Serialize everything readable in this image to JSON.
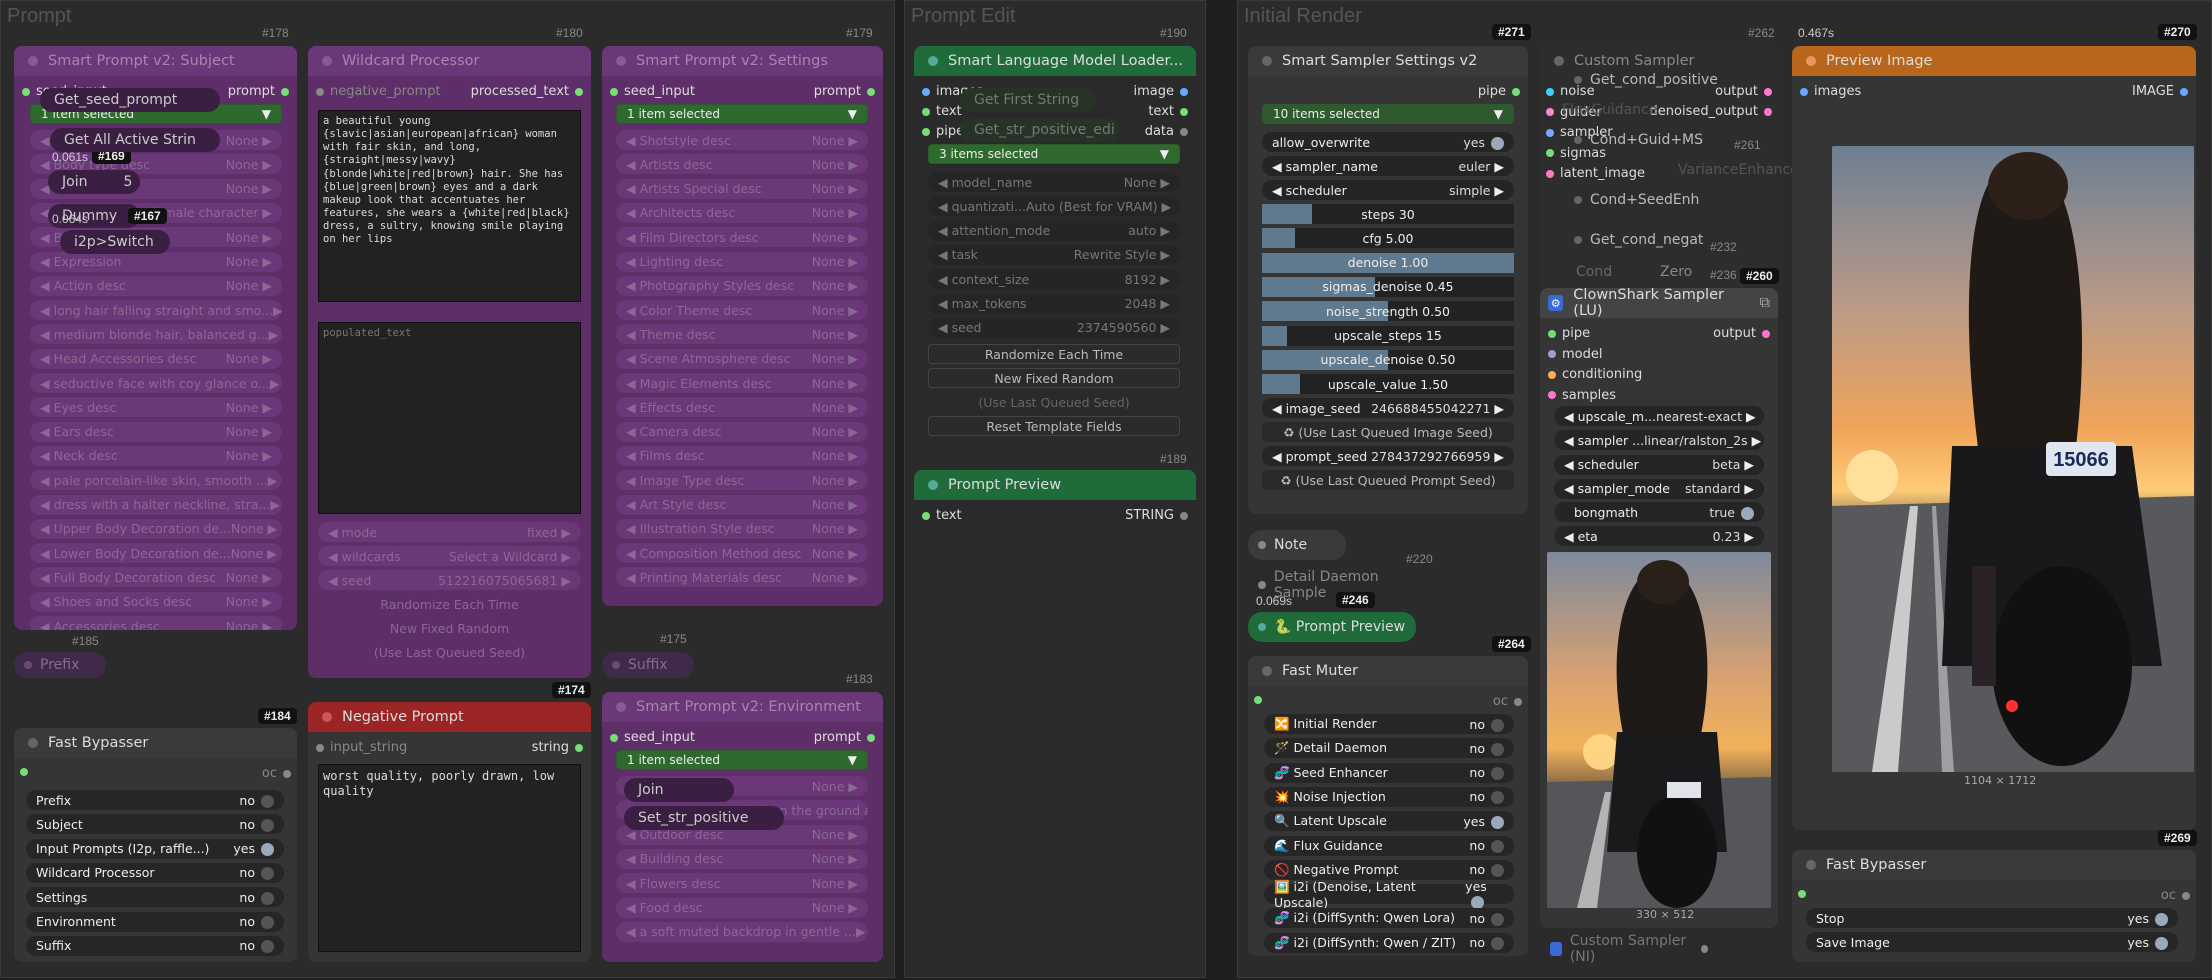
{
  "groups": {
    "prompt": "Prompt",
    "prompt_edit": "Prompt Edit",
    "initial_render": "Initial Render"
  },
  "subject": {
    "id": "#178",
    "title": "Smart Prompt v2: Subject",
    "in": "seed_input",
    "out": "prompt",
    "select": "1 item selected",
    "rows": [
      {
        "l": "Subject desc",
        "v": "None"
      },
      {
        "l": "Body type desc",
        "v": "None"
      },
      {
        "l": "Hair desc",
        "v": "None"
      },
      {
        "l": "Style desc",
        "v": "female character"
      },
      {
        "l": "Body desc",
        "v": "None"
      },
      {
        "l": "Expression",
        "v": "None"
      },
      {
        "l": "Action desc",
        "v": "None"
      },
      {
        "l": "long hair falling straight and smo...",
        "v": ""
      },
      {
        "l": "medium blonde hair, balanced g...",
        "v": ""
      },
      {
        "l": "Head Accessories desc",
        "v": "None"
      },
      {
        "l": "seductive face with coy glance o...",
        "v": ""
      },
      {
        "l": "Eyes desc",
        "v": "None"
      },
      {
        "l": "Ears desc",
        "v": "None"
      },
      {
        "l": "Neck desc",
        "v": "None"
      },
      {
        "l": "pale porcelain-like skin, smooth ...",
        "v": ""
      },
      {
        "l": "dress with a halter neckline, stra...",
        "v": ""
      },
      {
        "l": "Upper Body Decoration de...",
        "v": "None"
      },
      {
        "l": "Lower Body Decoration de...",
        "v": "None"
      },
      {
        "l": "Full Body Decoration desc",
        "v": "None"
      },
      {
        "l": "Shoes and Socks desc",
        "v": "None"
      },
      {
        "l": "Accessories desc",
        "v": "None"
      }
    ],
    "overlay": [
      "Get_seed_prompt",
      "Get All Active Strin",
      "Join",
      "Dummy",
      "i2p>Switch"
    ],
    "t1": "0.061s",
    "id169": "#169",
    "t2": "0.064s",
    "id167": "#167",
    "n5": "5"
  },
  "wildcard": {
    "id": "#180",
    "title": "Wildcard Processor",
    "in": "negative_prompt",
    "out": "processed_text",
    "text": "a beautiful young {slavic|asian|european|african} woman with fair skin, and long, {straight|messy|wavy} {blonde|white|red|brown} hair. She has {blue|green|brown} eyes and a dark makeup look that accentuates her features, she wears a {white|red|black} dress, a sultry, knowing smile playing on her lips",
    "placeholder": "populated_text",
    "rows": [
      {
        "l": "mode",
        "v": "fixed"
      },
      {
        "l": "wildcards",
        "v": "Select a Wildcard"
      },
      {
        "l": "seed",
        "v": "512216075065681"
      }
    ],
    "btn1": "Randomize Each Time",
    "btn2": "New Fixed Random",
    "btn3": "(Use Last Queued Seed)"
  },
  "settings": {
    "id": "#179",
    "title": "Smart Prompt v2: Settings",
    "in": "seed_input",
    "out": "prompt",
    "select": "1 item selected",
    "rows": [
      {
        "l": "Shotstyle desc",
        "v": "None"
      },
      {
        "l": "Artists desc",
        "v": "None"
      },
      {
        "l": "Artists Special desc",
        "v": "None"
      },
      {
        "l": "Architects desc",
        "v": "None"
      },
      {
        "l": "Film Directors desc",
        "v": "None"
      },
      {
        "l": "Lighting desc",
        "v": "None"
      },
      {
        "l": "Photography Styles desc",
        "v": "None"
      },
      {
        "l": "Color Theme desc",
        "v": "None"
      },
      {
        "l": "Theme desc",
        "v": "None"
      },
      {
        "l": "Scene Atmosphere desc",
        "v": "None"
      },
      {
        "l": "Magic Elements desc",
        "v": "None"
      },
      {
        "l": "Effects desc",
        "v": "None"
      },
      {
        "l": "Camera desc",
        "v": "None"
      },
      {
        "l": "Films desc",
        "v": "None"
      },
      {
        "l": "Image Type desc",
        "v": "None"
      },
      {
        "l": "Art Style desc",
        "v": "None"
      },
      {
        "l": "Illustration Style desc",
        "v": "None"
      },
      {
        "l": "Composition Method desc",
        "v": "None"
      },
      {
        "l": "Printing Materials desc",
        "v": "None"
      }
    ]
  },
  "prefix": {
    "id": "#185",
    "label": "Prefix"
  },
  "suffix": {
    "id": "#175",
    "label": "Suffix"
  },
  "bypass1": {
    "id": "#184",
    "title": "Fast Bypasser",
    "oc": "oc",
    "rows": [
      {
        "l": "Prefix",
        "v": "no",
        "on": false
      },
      {
        "l": "Subject",
        "v": "no",
        "on": false
      },
      {
        "l": "Input Prompts (I2p, raffle...)",
        "v": "yes",
        "on": true
      },
      {
        "l": "Wildcard Processor",
        "v": "no",
        "on": false
      },
      {
        "l": "Settings",
        "v": "no",
        "on": false
      },
      {
        "l": "Environment",
        "v": "no",
        "on": false
      },
      {
        "l": "Suffix",
        "v": "no",
        "on": false
      }
    ]
  },
  "negative": {
    "id": "#174",
    "title": "Negative Prompt",
    "in": "input_string",
    "out": "string",
    "text": "worst quality, poorly drawn, low quality"
  },
  "environment": {
    "id": "#183",
    "title": "Smart Prompt v2: Environment",
    "in": "seed_input",
    "out": "prompt",
    "select": "1 item selected",
    "rows": [
      {
        "l": "Location desc",
        "v": "None"
      },
      {
        "l": "a motorcycle parked on the ground around",
        "v": ""
      },
      {
        "l": "Outdoor desc",
        "v": "None"
      },
      {
        "l": "Building desc",
        "v": "None"
      },
      {
        "l": "Flowers desc",
        "v": "None"
      },
      {
        "l": "Food desc",
        "v": "None"
      },
      {
        "l": "a soft muted backdrop in gentle ...",
        "v": ""
      }
    ],
    "overlay": [
      "Join",
      "Set_str_positive"
    ]
  },
  "slm": {
    "id": "#190",
    "title": "Smart Language Model Loader...",
    "ins": [
      "images",
      "text",
      "pipe_opt"
    ],
    "outs": [
      "image",
      "text",
      "data"
    ],
    "select": "3 items selected",
    "rows": [
      {
        "l": "model_name",
        "v": "None"
      },
      {
        "l": "quantizati...",
        "v": "Auto (Best for VRAM)"
      },
      {
        "l": "attention_mode",
        "v": "auto"
      },
      {
        "l": "task",
        "v": "Rewrite Style"
      },
      {
        "l": "context_size",
        "v": "8192"
      },
      {
        "l": "max_tokens",
        "v": "2048"
      },
      {
        "l": "seed",
        "v": "2374590560"
      }
    ],
    "btn1": "Randomize Each Time",
    "btn2": "New Fixed Random",
    "btn3": "(Use Last Queued Seed)",
    "btn4": "Reset Template Fields",
    "overlay": [
      "Get First String",
      "Get_str_positive_edi"
    ],
    "n4": "4"
  },
  "preview1": {
    "id": "#189",
    "title": "Prompt Preview",
    "in": "text",
    "out": "STRING"
  },
  "sampler_settings": {
    "id": "#271",
    "title": "Smart Sampler Settings v2",
    "out": "pipe",
    "select": "10 items selected",
    "allow": {
      "l": "allow_overwrite",
      "v": "yes"
    },
    "sampler": {
      "l": "sampler_name",
      "v": "euler"
    },
    "scheduler": {
      "l": "scheduler",
      "v": "simple"
    },
    "sliders": [
      {
        "l": "steps",
        "v": "30",
        "f": 0.2
      },
      {
        "l": "cfg",
        "v": "5.00",
        "f": 0.13
      },
      {
        "l": "denoise",
        "v": "1.00",
        "f": 1.0
      },
      {
        "l": "sigmas_denoise",
        "v": "0.45",
        "f": 0.45
      },
      {
        "l": "noise_strength",
        "v": "0.50",
        "f": 0.5
      },
      {
        "l": "upscale_steps",
        "v": "15",
        "f": 0.1
      },
      {
        "l": "upscale_denoise",
        "v": "0.50",
        "f": 0.5
      },
      {
        "l": "upscale_value",
        "v": "1.50",
        "f": 0.15
      }
    ],
    "image_seed": {
      "l": "image_seed",
      "v": "246688455042271"
    },
    "btn1": "(Use Last Queued Image Seed)",
    "prompt_seed": {
      "l": "prompt_seed",
      "v": "278437292766959"
    },
    "btn2": "(Use Last Queued Prompt Seed)"
  },
  "custom_sampler": {
    "id": "#262",
    "title": "Custom Sampler",
    "ins": [
      "noise",
      "guider",
      "sampler",
      "sigmas",
      "latent_image"
    ],
    "outs": [
      "output",
      "denoised_output"
    ],
    "overlay": [
      "Get_cond_positive",
      "FluxGuidance",
      "Cond+Guid+MS",
      "VarianceEnhancer",
      "Cond+SeedEnh",
      "Get_cond_negat",
      "Cond",
      "Zero"
    ],
    "id261": "#261",
    "id232": "#232",
    "id236": "#236"
  },
  "clownshark": {
    "id": "#260",
    "title": "ClownShark Sampler (LU)",
    "ins": [
      "pipe",
      "model",
      "conditioning",
      "samples"
    ],
    "out": "output",
    "rows": [
      {
        "l": "upscale_m...",
        "v": "nearest-exact"
      },
      {
        "l": "sampler ...",
        "v": "linear/ralston_2s"
      },
      {
        "l": "scheduler",
        "v": "beta"
      },
      {
        "l": "sampler_mode",
        "v": "standard"
      }
    ],
    "bongmath": {
      "l": "bongmath",
      "v": "true"
    },
    "eta": {
      "l": "eta",
      "v": "0.23"
    },
    "caption": "330 × 512"
  },
  "note": {
    "label": "Note"
  },
  "daemon": {
    "label": "Detail Daemon Sample",
    "id": "#220",
    "time": "0.069s",
    "id246": "#246"
  },
  "preview2": {
    "label": "Prompt Preview"
  },
  "muter": {
    "id": "#264",
    "title": "Fast Muter",
    "oc": "oc",
    "rows": [
      {
        "l": "🔀 Initial Render",
        "v": "no",
        "on": false
      },
      {
        "l": "🪄 Detail Daemon",
        "v": "no",
        "on": false
      },
      {
        "l": "🧬 Seed Enhancer",
        "v": "no",
        "on": false
      },
      {
        "l": "💥 Noise Injection",
        "v": "no",
        "on": false
      },
      {
        "l": "🔍 Latent Upscale",
        "v": "yes",
        "on": true
      },
      {
        "l": "🌊 Flux Guidance",
        "v": "no",
        "on": false
      },
      {
        "l": "🚫 Negative Prompt",
        "v": "no",
        "on": false
      },
      {
        "l": "🖼️ i2i (Denoise, Latent Upscale)",
        "v": "yes",
        "on": true
      },
      {
        "l": "🧬 i2i (DiffSynth: Qwen Lora)",
        "v": "no",
        "on": false
      },
      {
        "l": "🧬 i2i (DiffSynth: Qwen / ZIT)",
        "v": "no",
        "on": false
      }
    ]
  },
  "custom2": {
    "label": "Custom Sampler (NI)"
  },
  "preview_image": {
    "id": "#270",
    "title": "Preview Image",
    "time": "0.467s",
    "in": "images",
    "out": "IMAGE",
    "caption": "1104 × 1712",
    "plate": "15066"
  },
  "bypass2": {
    "id": "#269",
    "title": "Fast Bypasser",
    "oc": "oc",
    "rows": [
      {
        "l": "Stop",
        "v": "yes",
        "on": true
      },
      {
        "l": "Save Image",
        "v": "yes",
        "on": true
      }
    ]
  },
  "colors": {
    "purple": "#5e2e68",
    "green": "#1f6b3a",
    "red": "#9b2424",
    "orange": "#b8661c",
    "slider": "#5f7a8f"
  }
}
